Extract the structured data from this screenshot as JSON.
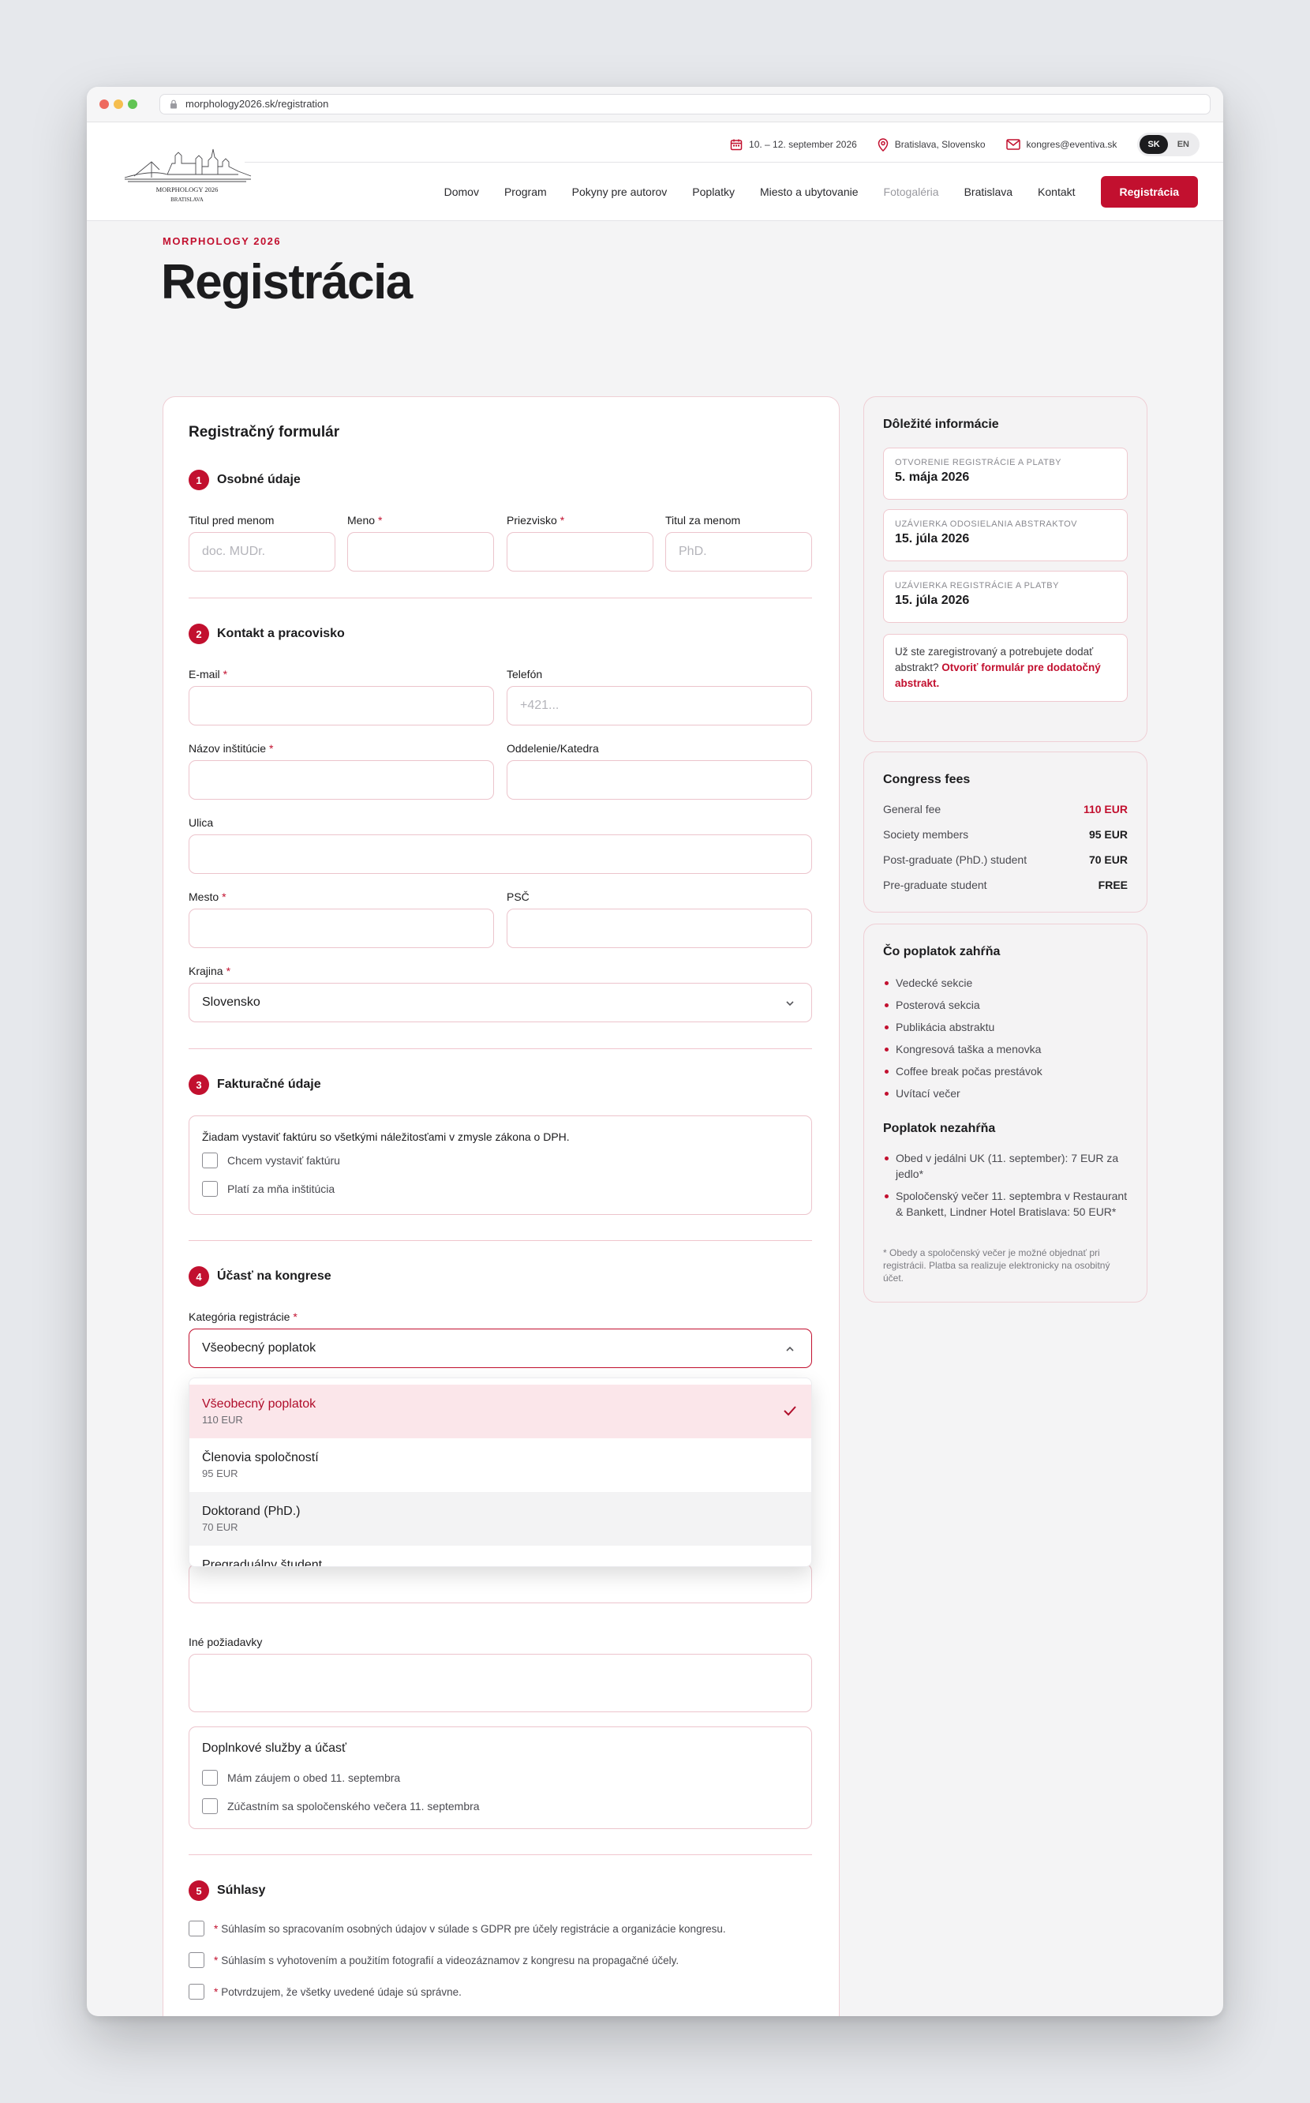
{
  "browser": {
    "url": "morphology2026.sk/registration"
  },
  "header": {
    "logo_caption": "MORPHOLOGY 2026",
    "logo_sub": "BRATISLAVA",
    "date": "10. – 12. september 2026",
    "location": "Bratislava, Slovensko",
    "email": "kongres@eventiva.sk",
    "lang": [
      "SK",
      "EN"
    ],
    "nav": [
      "Domov",
      "Program",
      "Pokyny pre autorov",
      "Poplatky",
      "Miesto a ubytovanie",
      "Fotogaléria",
      "Bratislava",
      "Kontakt"
    ],
    "cta": "Registrácia"
  },
  "page": {
    "eyebrow": "MORPHOLOGY 2026",
    "title": "Registrácia"
  },
  "form": {
    "title": "Registračný formulár",
    "sections": [
      {
        "num": "1",
        "title": "Osobné údaje"
      },
      {
        "num": "2",
        "title": "Kontakt a pracovisko"
      },
      {
        "num": "3",
        "title": "Fakturačné údaje"
      },
      {
        "num": "4",
        "title": "Účasť na kongrese"
      },
      {
        "num": "5",
        "title": "Súhlasy"
      }
    ],
    "personal": {
      "title_before": {
        "label": "Titul pred menom",
        "placeholder": "doc. MUDr."
      },
      "first": {
        "label": "Meno"
      },
      "last": {
        "label": "Priezvisko"
      },
      "title_after": {
        "label": "Titul za menom",
        "placeholder": "PhD."
      }
    },
    "contact": {
      "email": "E-mail",
      "phone": {
        "label": "Telefón",
        "placeholder": "+421..."
      },
      "institution": "Názov inštitúcie",
      "department": "Oddelenie/Katedra",
      "street": "Ulica",
      "city": "Mesto",
      "zip": "PSČ",
      "country": {
        "label": "Krajina",
        "value": "Slovensko"
      }
    },
    "billing": {
      "intro": "Žiadam vystaviť faktúru so všetkými náležitosťami v zmysle zákona o DPH.",
      "options": [
        "Chcem vystaviť faktúru",
        "Platí za mňa inštitúcia"
      ]
    },
    "attendance": {
      "category_label": "Kategória registrácie",
      "category_value": "Všeobecný poplatok",
      "options": [
        {
          "title": "Všeobecný poplatok",
          "price": "110 EUR"
        },
        {
          "title": "Členovia spoločností",
          "price": "95 EUR"
        },
        {
          "title": "Doktorand (PhD.)",
          "price": "70 EUR"
        },
        {
          "title": "Pregraduálny študent",
          "price": ""
        }
      ],
      "other_label": "Iné požiadavky",
      "extras_title": "Doplnkové služby a účasť",
      "extras": [
        "Mám záujem o obed 11. septembra",
        "Zúčastním sa spoločenského večera 11. septembra"
      ]
    },
    "consents": [
      "Súhlasím so spracovaním osobných údajov v súlade s GDPR pre účely registrácie a organizácie kongresu.",
      "Súhlasím s vyhotovením a použitím fotografií a videozáznamov z kongresu na propagačné účely.",
      "Potvrdzujem, že všetky uvedené údaje sú správne."
    ]
  },
  "sidebar": {
    "info": {
      "title": "Dôležité informácie",
      "items": [
        {
          "label": "OTVORENIE REGISTRÁCIE A PLATBY",
          "value": "5. mája 2026"
        },
        {
          "label": "UZÁVIERKA ODOSIELANIA ABSTRAKTOV",
          "value": "15. júla 2026"
        },
        {
          "label": "UZÁVIERKA REGISTRÁCIE A PLATBY",
          "value": "15. júla 2026"
        }
      ],
      "note_text": "Už ste zaregistrovaný a potrebujete dodať abstrakt?",
      "note_link": "Otvoriť formulár pre dodatočný abstrakt."
    },
    "fees": {
      "title": "Congress fees",
      "rows": [
        {
          "name": "General fee",
          "price": "110 EUR"
        },
        {
          "name": "Society members",
          "price": "95 EUR"
        },
        {
          "name": "Post-graduate (PhD.) student",
          "price": "70 EUR"
        },
        {
          "name": "Pre-graduate student",
          "price": "FREE"
        }
      ]
    },
    "includes": {
      "title": "Čo poplatok zahŕňa",
      "items": [
        "Vedecké sekcie",
        "Posterová sekcia",
        "Publikácia abstraktu",
        "Kongresová taška a menovka",
        "Coffee break počas prestávok",
        "Uvítací večer"
      ],
      "excluded_title": "Poplatok nezahŕňa",
      "excluded": [
        "Obed v jedálni UK (11. september): 7 EUR za jedlo*",
        "Spoločenský večer 11. septembra v Restaurant & Bankett, Lindner Hotel Bratislava: 50 EUR*"
      ],
      "footnote": "* Obedy a spoločenský večer je možné objednať pri registrácii. Platba sa realizuje elektronicky na osobitný účet."
    }
  },
  "colors": {
    "accent": "#c2102f",
    "border": "#ecc4cc"
  }
}
